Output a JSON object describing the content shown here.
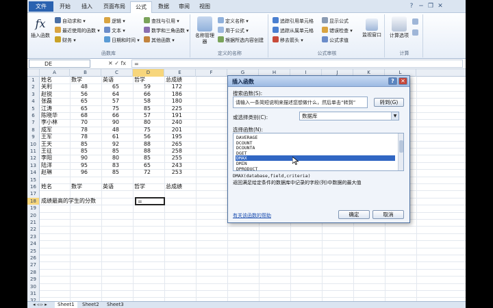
{
  "ribbon": {
    "tabs": [
      "文件",
      "开始",
      "插入",
      "页面布局",
      "公式",
      "数据",
      "审阅",
      "视图"
    ],
    "active_tab": "公式",
    "groups": {
      "library": {
        "label": "函数库",
        "insert_function": "插入函数",
        "items": [
          "自动求和",
          "最近使用的函数",
          "财务",
          "逻辑",
          "文本",
          "日期和时间",
          "查找与引用",
          "数学和三角函数",
          "其他函数"
        ]
      },
      "names": {
        "label": "定义的名称",
        "name_manager": "名称管理器",
        "items": [
          "定义名称",
          "用于公式",
          "根据所选内容创建"
        ]
      },
      "audit": {
        "label": "公式审核",
        "items": [
          "追踪引用单元格",
          "追踪从属单元格",
          "移去箭头",
          "显示公式",
          "错误检查",
          "公式求值"
        ],
        "watch_window": "监视窗口"
      },
      "calc": {
        "label": "计算",
        "calc_options": "计算选项"
      }
    }
  },
  "formula_bar": {
    "name_box": "DE",
    "buttons": "✕ ✓ fx",
    "formula": "="
  },
  "sheet": {
    "columns": [
      "A",
      "B",
      "C",
      "D",
      "E",
      "F",
      "G",
      "H",
      "I",
      "J",
      "K",
      "L"
    ],
    "selected_column": "D",
    "selected_row": "18",
    "row_numbers": [
      "1",
      "2",
      "3",
      "4",
      "5",
      "6",
      "7",
      "8",
      "9",
      "10",
      "11",
      "12",
      "13",
      "14",
      "15",
      "16",
      "17",
      "18",
      "19",
      "20",
      "21",
      "22",
      "23",
      "24",
      "25",
      "26",
      "27",
      "28",
      "29",
      "30",
      "31",
      "32"
    ],
    "header": [
      "姓名",
      "数学",
      "英语",
      "哲学",
      "总成绩"
    ],
    "rows": [
      [
        "关利",
        "48",
        "65",
        "59",
        "172"
      ],
      [
        "赵锐",
        "56",
        "64",
        "66",
        "186"
      ],
      [
        "张磊",
        "65",
        "57",
        "58",
        "180"
      ],
      [
        "江涛",
        "65",
        "75",
        "85",
        "225"
      ],
      [
        "陈晓华",
        "68",
        "66",
        "57",
        "191"
      ],
      [
        "李小林",
        "70",
        "90",
        "80",
        "240"
      ],
      [
        "成军",
        "78",
        "48",
        "75",
        "201"
      ],
      [
        "王军",
        "78",
        "61",
        "56",
        "195"
      ],
      [
        "王天",
        "85",
        "92",
        "88",
        "265"
      ],
      [
        "王征",
        "85",
        "85",
        "88",
        "258"
      ],
      [
        "李阳",
        "90",
        "80",
        "85",
        "255"
      ],
      [
        "陆洋",
        "95",
        "83",
        "65",
        "243"
      ],
      [
        "赵琳",
        "96",
        "85",
        "72",
        "253"
      ]
    ],
    "criteria_header": [
      "姓名",
      "数学",
      "英语",
      "哲学",
      "总成绩"
    ],
    "question": "成绩最高的学生的分数",
    "active_value": "=",
    "sheet_tabs": [
      "Sheet1",
      "Sheet2",
      "Sheet3"
    ]
  },
  "dialog": {
    "title": "插入函数",
    "search_label": "搜索函数(S):",
    "search_value": "请输入一条简短说明来描述您想做什么，然后单击“转到”",
    "go_button": "转到(G)",
    "category_label": "或选择类别(C):",
    "category_value": "数据库",
    "select_label": "选择函数(N):",
    "functions": [
      "DAVERAGE",
      "DCOUNT",
      "DCOUNTA",
      "DGET",
      "DMAX",
      "DMIN",
      "DPRODUCT"
    ],
    "selected_function": "DMAX",
    "signature": "DMAX(database,field,criteria)",
    "description": "返回满足给定条件的数据库中记录的字段(列)中数据的最大值",
    "help_link": "有关该函数的帮助",
    "ok_button": "确定",
    "cancel_button": "取消"
  },
  "colors": {
    "file_tab": "#2a62b0",
    "selection_highlight": "#f7d67c",
    "list_selection": "#3167c3"
  }
}
